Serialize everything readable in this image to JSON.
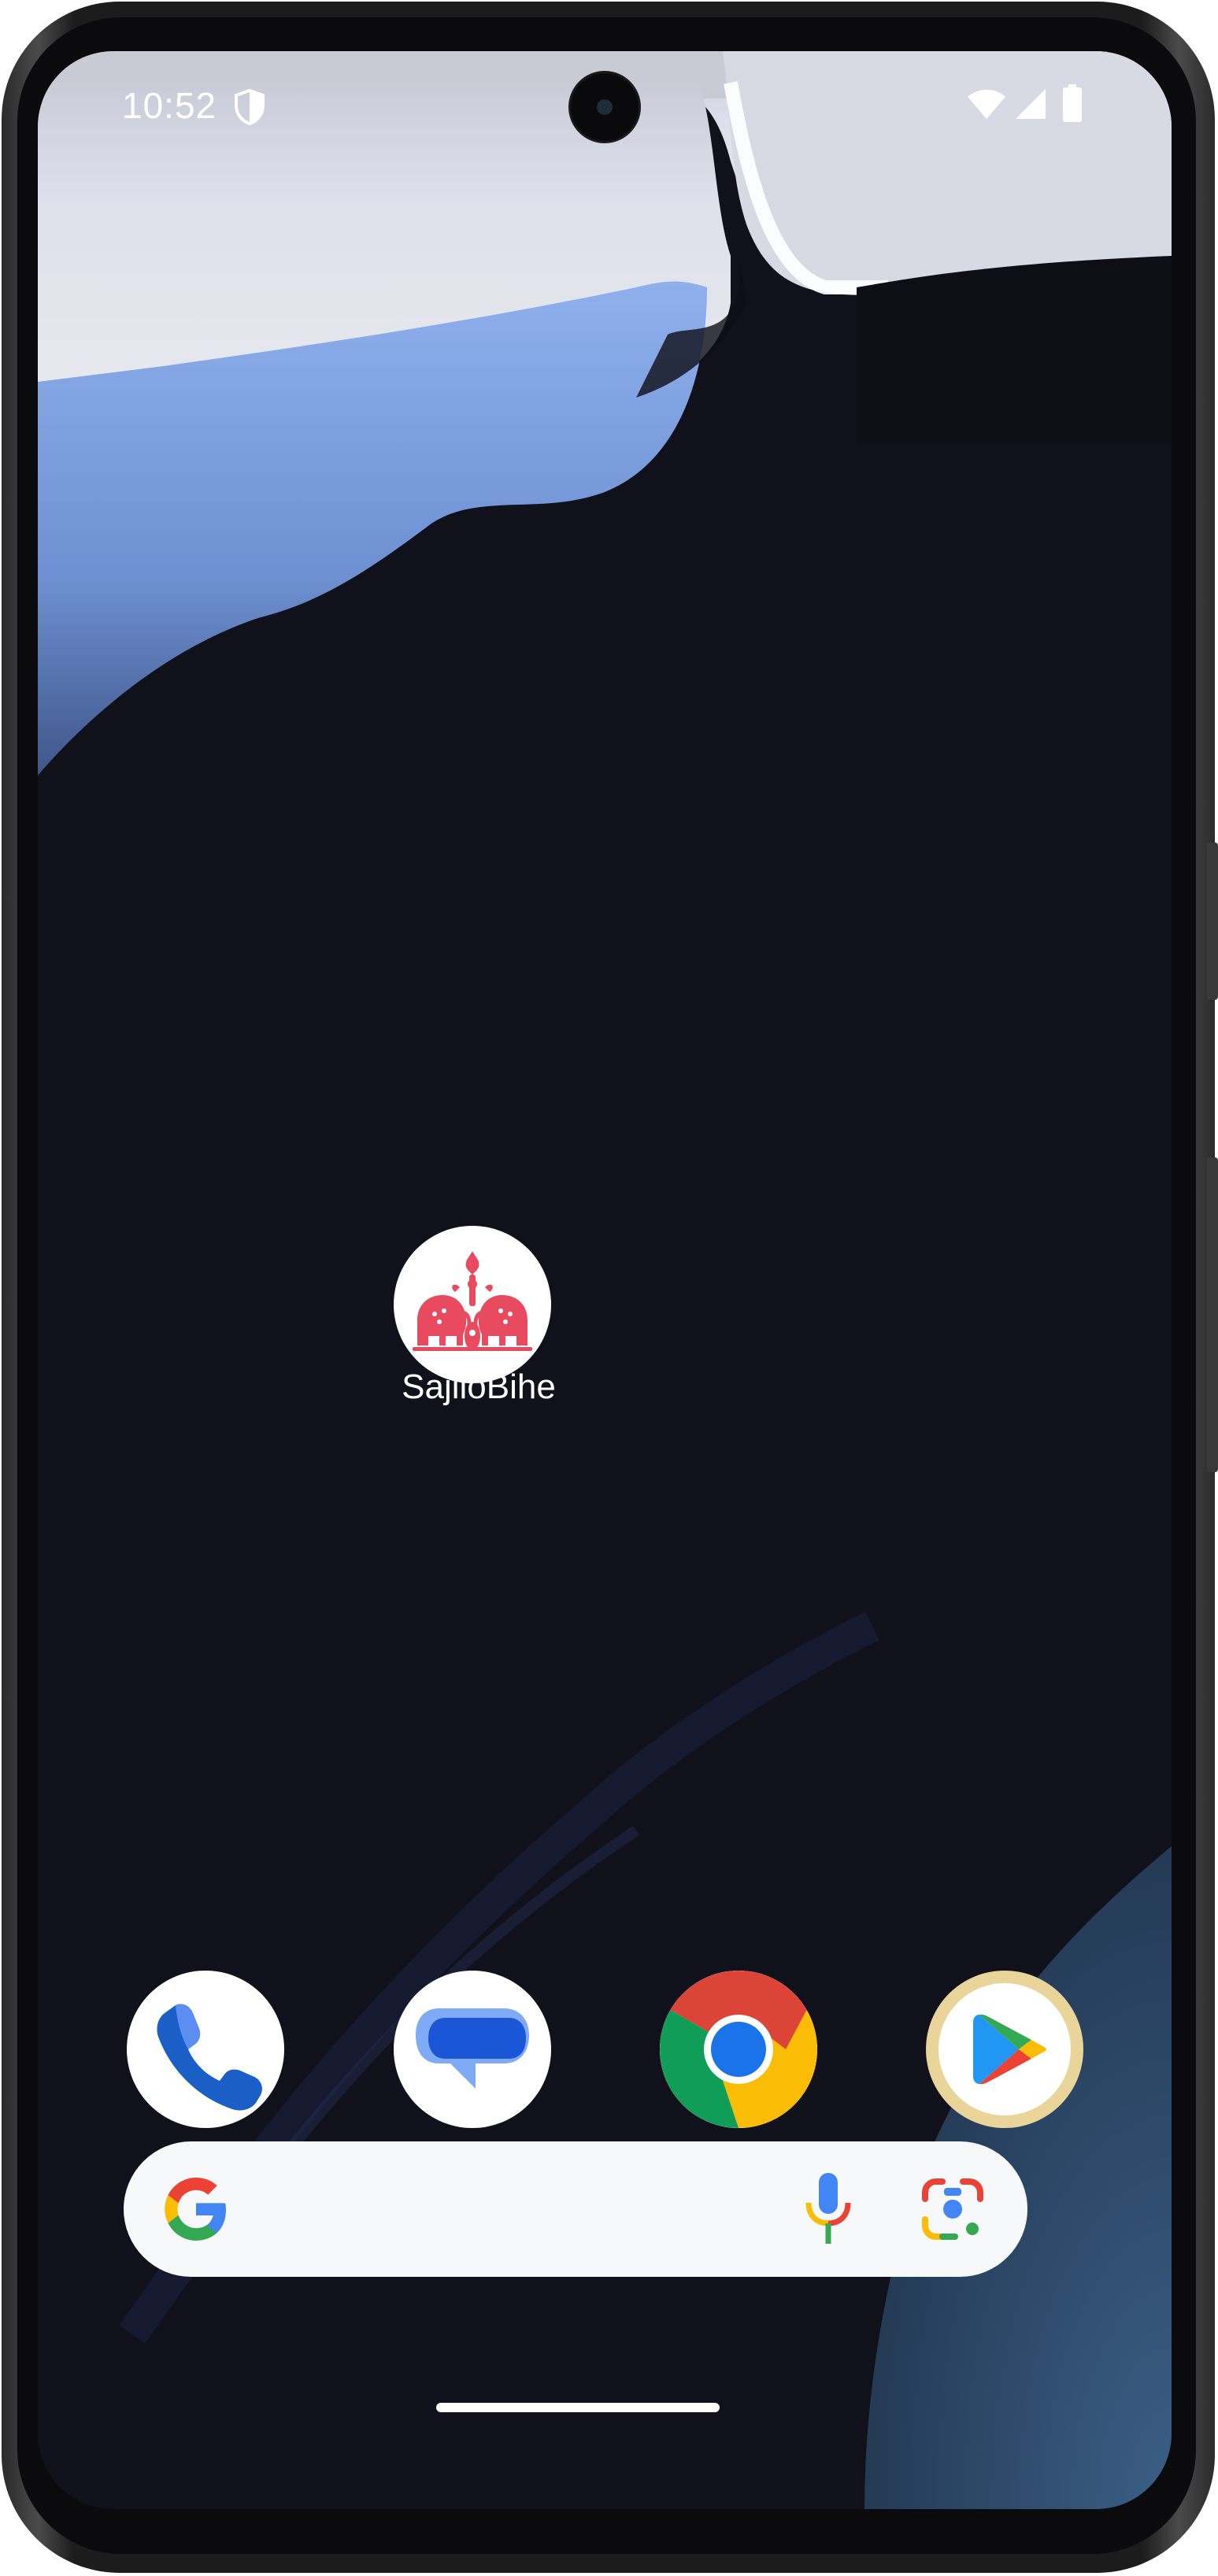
{
  "status_bar": {
    "time": "10:52",
    "icons": [
      "vpn-shield-icon",
      "wifi-icon",
      "cell-signal-icon",
      "battery-icon"
    ]
  },
  "home_screen": {
    "apps": [
      {
        "label": "SajiloBihe",
        "icon": "sajilobihe-elephant-logo",
        "accent": "#e84a5f"
      }
    ]
  },
  "dock": {
    "apps": [
      {
        "name": "Phone",
        "icon": "phone-icon"
      },
      {
        "name": "Messages",
        "icon": "messages-icon"
      },
      {
        "name": "Chrome",
        "icon": "chrome-icon"
      },
      {
        "name": "Play Store",
        "icon": "play-store-icon"
      }
    ]
  },
  "search_bar": {
    "icons": [
      "google-g-icon",
      "mic-icon",
      "google-lens-icon"
    ]
  },
  "colors": {
    "wallpaper_dark": "#11111a",
    "wallpaper_light": "#7fa3e0",
    "google_blue": "#4285f4",
    "google_red": "#ea4335",
    "google_yellow": "#fbbc05",
    "google_green": "#34a853"
  }
}
